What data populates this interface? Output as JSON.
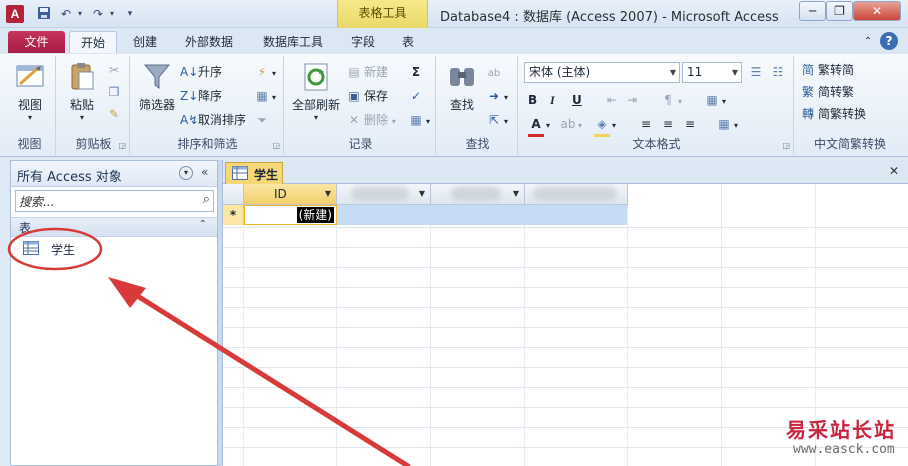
{
  "title_bar": {
    "app_icon_letter": "A",
    "context_group": "表格工具",
    "window_title": "Database4 : 数据库 (Access 2007) - Microsoft Access"
  },
  "ribbon_tabs": [
    "文件",
    "开始",
    "创建",
    "外部数据",
    "数据库工具",
    "字段",
    "表"
  ],
  "groups": {
    "views": {
      "label": "视图",
      "view_button": "视图"
    },
    "clipboard": {
      "label": "剪贴板",
      "paste_button": "粘贴"
    },
    "sort_filter": {
      "label": "排序和筛选",
      "filter_button": "筛选器",
      "ascending": "升序",
      "descending": "降序",
      "remove_sort": "取消排序"
    },
    "records": {
      "label": "记录",
      "refresh_all": "全部刷新",
      "new": "新建",
      "save": "保存",
      "delete": "删除"
    },
    "find": {
      "label": "查找",
      "find_button": "查找"
    },
    "text_format": {
      "label": "文本格式",
      "font": "宋体 (主体)",
      "font_size": "11",
      "bold": "B",
      "italic": "I",
      "underline": "U"
    },
    "chinese_conversion": {
      "label": "中文简繁转换",
      "to_simplified": "繁转简",
      "to_traditional": "简转繁",
      "convert": "简繁转换"
    }
  },
  "nav_pane": {
    "title": "所有 Access 对象",
    "search_placeholder": "搜索...",
    "section": "表",
    "items": [
      "学生"
    ]
  },
  "document": {
    "tab_title": "学生",
    "columns": [
      "ID",
      "",
      "",
      ""
    ],
    "new_record_marker": "*",
    "new_record_label": "(新建)"
  },
  "watermark": {
    "text": "易采站长站",
    "url": "www.easck.com"
  },
  "colors": {
    "file_tab": "#b5294e",
    "context_tab": "#f3e27f",
    "annotation": "#d83a3a",
    "selected_row": "#c6dcf5"
  }
}
